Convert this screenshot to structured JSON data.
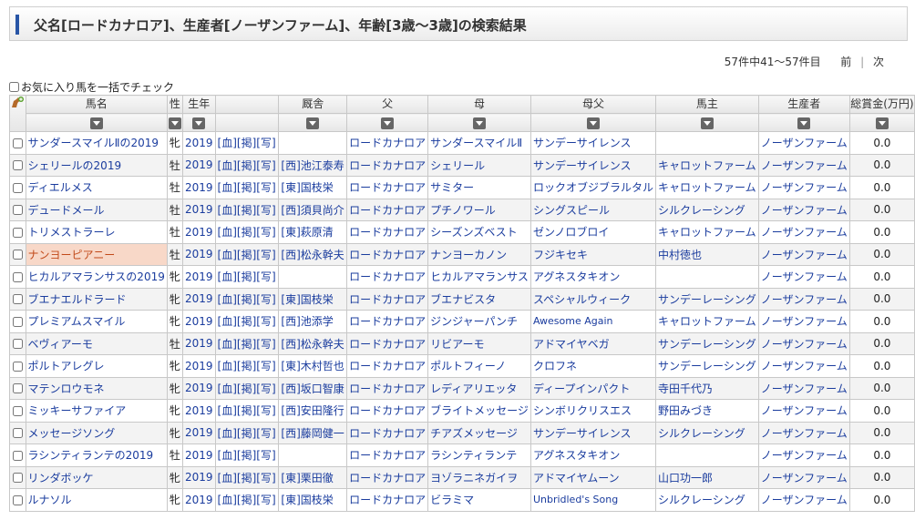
{
  "header": {
    "title": "父名[ロードカナロア]、生産者[ノーザンファーム]、年齢[3歳～3歳]の検索結果"
  },
  "pager": {
    "summary": "57件中41～57件目",
    "prev": "前",
    "sep": "|",
    "next": "次"
  },
  "bulk_check": {
    "label": "お気に入り馬を一括でチェック"
  },
  "columns": {
    "name": "馬名",
    "sex": "性",
    "year": "生年",
    "stable": "厩舎",
    "sire": "父",
    "dam": "母",
    "broodmare_sire": "母父",
    "owner": "馬主",
    "breeder": "生産者",
    "earnings": "総賞金(万円)"
  },
  "link_labels": {
    "blood": "[血]",
    "post": "[掲]",
    "photo": "[写]"
  },
  "rows": [
    {
      "name": "サンダースマイルⅡの2019",
      "sex": "牝",
      "year": "2019",
      "stable": "",
      "sire": "ロードカナロア",
      "dam": "サンダースマイルⅡ",
      "bms": "サンデーサイレンス",
      "owner": "",
      "breeder": "ノーザンファーム",
      "earnings": "0.0",
      "hl": false,
      "alt": false,
      "bmsSmall": false
    },
    {
      "name": "シェリールの2019",
      "sex": "牡",
      "year": "2019",
      "stable": "[西]池江泰寿",
      "sire": "ロードカナロア",
      "dam": "シェリール",
      "bms": "サンデーサイレンス",
      "owner": "キャロットファーム",
      "breeder": "ノーザンファーム",
      "earnings": "0.0",
      "hl": false,
      "alt": true,
      "bmsSmall": false
    },
    {
      "name": "ディエルメス",
      "sex": "牡",
      "year": "2019",
      "stable": "[東]国枝栄",
      "sire": "ロードカナロア",
      "dam": "サミター",
      "bms": "ロックオブジブラルタル",
      "owner": "キャロットファーム",
      "breeder": "ノーザンファーム",
      "earnings": "0.0",
      "hl": false,
      "alt": false,
      "bmsSmall": false
    },
    {
      "name": "デュードメール",
      "sex": "牡",
      "year": "2019",
      "stable": "[西]須貝尚介",
      "sire": "ロードカナロア",
      "dam": "プチノワール",
      "bms": "シングスピール",
      "owner": "シルクレーシング",
      "breeder": "ノーザンファーム",
      "earnings": "0.0",
      "hl": false,
      "alt": true,
      "bmsSmall": false
    },
    {
      "name": "トリメストラーレ",
      "sex": "牡",
      "year": "2019",
      "stable": "[東]萩原清",
      "sire": "ロードカナロア",
      "dam": "シーズンズベスト",
      "bms": "ゼンノロブロイ",
      "owner": "キャロットファーム",
      "breeder": "ノーザンファーム",
      "earnings": "0.0",
      "hl": false,
      "alt": false,
      "bmsSmall": false
    },
    {
      "name": "ナンヨーピアニー",
      "sex": "牡",
      "year": "2019",
      "stable": "[西]松永幹夫",
      "sire": "ロードカナロア",
      "dam": "ナンヨーカノン",
      "bms": "フジキセキ",
      "owner": "中村徳也",
      "breeder": "ノーザンファーム",
      "earnings": "0.0",
      "hl": true,
      "alt": true,
      "bmsSmall": false
    },
    {
      "name": "ヒカルアマランサスの2019",
      "sex": "牝",
      "year": "2019",
      "stable": "",
      "sire": "ロードカナロア",
      "dam": "ヒカルアマランサス",
      "bms": "アグネスタキオン",
      "owner": "",
      "breeder": "ノーザンファーム",
      "earnings": "0.0",
      "hl": false,
      "alt": false,
      "bmsSmall": false
    },
    {
      "name": "ブエナエルドラード",
      "sex": "牝",
      "year": "2019",
      "stable": "[東]国枝栄",
      "sire": "ロードカナロア",
      "dam": "ブエナビスタ",
      "bms": "スペシャルウィーク",
      "owner": "サンデーレーシング",
      "breeder": "ノーザンファーム",
      "earnings": "0.0",
      "hl": false,
      "alt": true,
      "bmsSmall": false
    },
    {
      "name": "プレミアムスマイル",
      "sex": "牝",
      "year": "2019",
      "stable": "[西]池添学",
      "sire": "ロードカナロア",
      "dam": "ジンジャーパンチ",
      "bms": "Awesome Again",
      "owner": "キャロットファーム",
      "breeder": "ノーザンファーム",
      "earnings": "0.0",
      "hl": false,
      "alt": false,
      "bmsSmall": true
    },
    {
      "name": "ベヴィアーモ",
      "sex": "牡",
      "year": "2019",
      "stable": "[西]松永幹夫",
      "sire": "ロードカナロア",
      "dam": "リビアーモ",
      "bms": "アドマイヤベガ",
      "owner": "サンデーレーシング",
      "breeder": "ノーザンファーム",
      "earnings": "0.0",
      "hl": false,
      "alt": true,
      "bmsSmall": false
    },
    {
      "name": "ポルトアレグレ",
      "sex": "牝",
      "year": "2019",
      "stable": "[東]木村哲也",
      "sire": "ロードカナロア",
      "dam": "ポルトフィーノ",
      "bms": "クロフネ",
      "owner": "サンデーレーシング",
      "breeder": "ノーザンファーム",
      "earnings": "0.0",
      "hl": false,
      "alt": false,
      "bmsSmall": false
    },
    {
      "name": "マテンロウモネ",
      "sex": "牝",
      "year": "2019",
      "stable": "[西]坂口智康",
      "sire": "ロードカナロア",
      "dam": "レディアリエッタ",
      "bms": "ディープインパクト",
      "owner": "寺田千代乃",
      "breeder": "ノーザンファーム",
      "earnings": "0.0",
      "hl": false,
      "alt": true,
      "bmsSmall": false
    },
    {
      "name": "ミッキーサファイア",
      "sex": "牝",
      "year": "2019",
      "stable": "[西]安田隆行",
      "sire": "ロードカナロア",
      "dam": "ブライトメッセージ",
      "bms": "シンボリクリスエス",
      "owner": "野田みづき",
      "breeder": "ノーザンファーム",
      "earnings": "0.0",
      "hl": false,
      "alt": false,
      "bmsSmall": false
    },
    {
      "name": "メッセージソング",
      "sex": "牝",
      "year": "2019",
      "stable": "[西]藤岡健一",
      "sire": "ロードカナロア",
      "dam": "チアズメッセージ",
      "bms": "サンデーサイレンス",
      "owner": "シルクレーシング",
      "breeder": "ノーザンファーム",
      "earnings": "0.0",
      "hl": false,
      "alt": true,
      "bmsSmall": false
    },
    {
      "name": "ラシンティランテの2019",
      "sex": "牡",
      "year": "2019",
      "stable": "",
      "sire": "ロードカナロア",
      "dam": "ラシンティランテ",
      "bms": "アグネスタキオン",
      "owner": "",
      "breeder": "ノーザンファーム",
      "earnings": "0.0",
      "hl": false,
      "alt": false,
      "bmsSmall": false
    },
    {
      "name": "リンダボッケ",
      "sex": "牝",
      "year": "2019",
      "stable": "[東]栗田徹",
      "sire": "ロードカナロア",
      "dam": "ヨゾラニネガイヲ",
      "bms": "アドマイヤムーン",
      "owner": "山口功一郎",
      "breeder": "ノーザンファーム",
      "earnings": "0.0",
      "hl": false,
      "alt": true,
      "bmsSmall": false
    },
    {
      "name": "ルナソル",
      "sex": "牝",
      "year": "2019",
      "stable": "[東]国枝栄",
      "sire": "ロードカナロア",
      "dam": "ビラミマ",
      "bms": "Unbridled's Song",
      "owner": "シルクレーシング",
      "breeder": "ノーザンファーム",
      "earnings": "0.0",
      "hl": false,
      "alt": false,
      "bmsSmall": true
    }
  ]
}
